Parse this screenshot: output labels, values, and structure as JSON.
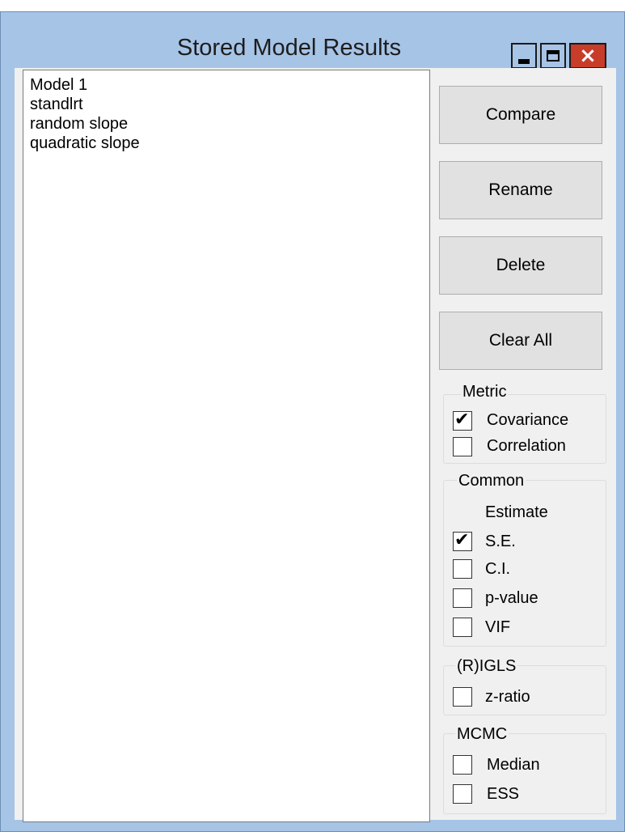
{
  "window": {
    "title": "Stored Model Results",
    "controls": {
      "minimize": "minimize",
      "maximize": "maximize",
      "close": "×"
    }
  },
  "models": [
    "Model 1",
    "standlrt",
    "random slope",
    "quadratic slope"
  ],
  "buttons": {
    "compare": "Compare",
    "rename": "Rename",
    "delete": "Delete",
    "clear_all": "Clear All"
  },
  "metric": {
    "legend": "Metric",
    "covariance": {
      "label": "Covariance",
      "checked": true
    },
    "correlation": {
      "label": "Correlation",
      "checked": false
    }
  },
  "common": {
    "legend": "Common",
    "estimate_label": "Estimate",
    "se": {
      "label": "S.E.",
      "checked": true
    },
    "ci": {
      "label": "C.I.",
      "checked": false
    },
    "pvalue": {
      "label": "p-value",
      "checked": false
    },
    "vif": {
      "label": "VIF",
      "checked": false
    }
  },
  "rigls": {
    "legend": "(R)IGLS",
    "zratio": {
      "label": "z-ratio",
      "checked": false
    }
  },
  "mcmc": {
    "legend": "MCMC",
    "median": {
      "label": "Median",
      "checked": false
    },
    "ess": {
      "label": "ESS",
      "checked": false
    }
  },
  "check_glyph": "✔",
  "colors": {
    "frame": "#a6c4e6",
    "close": "#c73d2a",
    "button": "#e1e1e1",
    "client": "#f0f0f0"
  }
}
